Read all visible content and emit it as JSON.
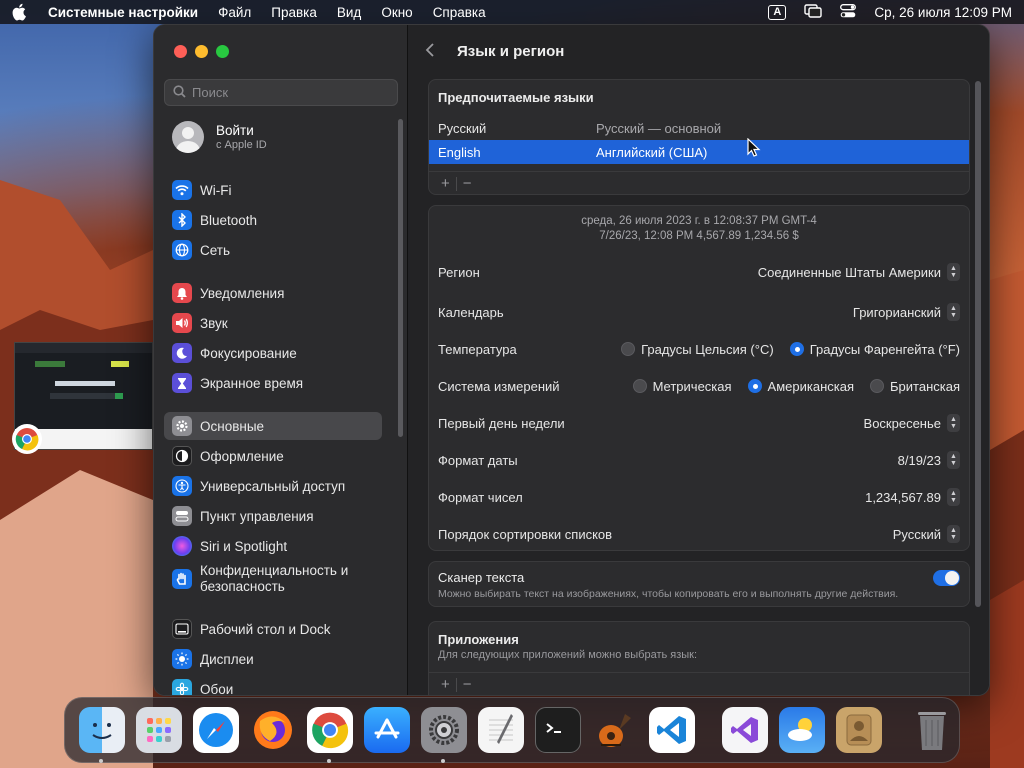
{
  "menubar": {
    "app_name": "Системные настройки",
    "items": [
      "Файл",
      "Правка",
      "Вид",
      "Окно",
      "Справка"
    ],
    "input_indicator": "A",
    "datetime": "Ср, 26 июля  12:09 PM"
  },
  "sidebar": {
    "search_placeholder": "Поиск",
    "account_title": "Войти",
    "account_sub": "с Apple ID",
    "items": [
      {
        "label": "Wi-Fi",
        "icon": "wifi-icon",
        "color": "#1a73e8"
      },
      {
        "label": "Bluetooth",
        "icon": "bluetooth-icon",
        "color": "#1a73e8"
      },
      {
        "label": "Сеть",
        "icon": "globe-icon",
        "color": "#1a73e8"
      },
      {
        "label": "Уведомления",
        "icon": "bell-icon",
        "color": "#e5484d"
      },
      {
        "label": "Звук",
        "icon": "speaker-icon",
        "color": "#e5484d"
      },
      {
        "label": "Фокусирование",
        "icon": "moon-icon",
        "color": "#5b4fd8"
      },
      {
        "label": "Экранное время",
        "icon": "hourglass-icon",
        "color": "#5b4fd8"
      },
      {
        "label": "Основные",
        "icon": "gear-icon",
        "color": "#8e8e93"
      },
      {
        "label": "Оформление",
        "icon": "appearance-icon",
        "color": "#1c1c1e"
      },
      {
        "label": "Универсальный доступ",
        "icon": "accessibility-icon",
        "color": "#1a73e8"
      },
      {
        "label": "Пункт управления",
        "icon": "control-center-icon",
        "color": "#8e8e93"
      },
      {
        "label": "Siri и Spotlight",
        "icon": "siri-icon",
        "color": "#2b2b2d"
      },
      {
        "label": "Конфиденциальность и безопасность",
        "icon": "hand-icon",
        "color": "#1a73e8"
      },
      {
        "label": "Рабочий стол и Dock",
        "icon": "dock-icon",
        "color": "#1c1c1e"
      },
      {
        "label": "Дисплеи",
        "icon": "sun-icon",
        "color": "#1a73e8"
      },
      {
        "label": "Обои",
        "icon": "wallpaper-icon",
        "color": "#2aa7e0"
      }
    ]
  },
  "main": {
    "title": "Язык и регион",
    "languages": {
      "title": "Предпочитаемые языки",
      "rows": [
        {
          "name": "Русский",
          "desc": "Русский — основной"
        },
        {
          "name": "English",
          "desc": "Английский (США)"
        }
      ],
      "add": "+",
      "remove": "−"
    },
    "preview": {
      "line1": "среда, 26 июля 2023 г. в 12:08:37 PM GMT-4",
      "line2": "7/26/23, 12:08 PM      4,567.89      1,234.56 $"
    },
    "settings": {
      "region": {
        "label": "Регион",
        "value": "Соединенные Штаты Америки"
      },
      "calendar": {
        "label": "Календарь",
        "value": "Григорианский"
      },
      "temperature": {
        "label": "Температура",
        "options": [
          "Градусы Цельсия (°C)",
          "Градусы Фаренгейта (°F)"
        ],
        "selected": 1
      },
      "measurement": {
        "label": "Система измерений",
        "options": [
          "Метрическая",
          "Американская",
          "Британская"
        ],
        "selected": 1
      },
      "first_day": {
        "label": "Первый день недели",
        "value": "Воскресенье"
      },
      "date_format": {
        "label": "Формат даты",
        "value": "8/19/23"
      },
      "number_format": {
        "label": "Формат чисел",
        "value": "1,234,567.89"
      },
      "sort_order": {
        "label": "Порядок сортировки списков",
        "value": "Русский"
      }
    },
    "live_text": {
      "title": "Сканер текста",
      "desc": "Можно выбирать текст на изображениях, чтобы копировать его и выполнять другие действия.",
      "enabled": true
    },
    "apps": {
      "title": "Приложения",
      "desc": "Для следующих приложений можно выбрать язык:",
      "add": "+",
      "remove": "−"
    }
  },
  "dock": [
    "finder-icon",
    "launchpad-icon",
    "safari-icon",
    "firefox-icon",
    "chrome-icon",
    "app-store-icon",
    "system-settings-icon",
    "textedit-icon",
    "terminal-icon",
    "garageband-icon",
    "vscode-icon",
    "visual-studio-icon",
    "weather-icon",
    "contacts-icon",
    "trash-icon"
  ],
  "colors": {
    "accent": "#1f63d8",
    "selection": "#1f63d8",
    "toggle_on": "#1f6fe5"
  }
}
